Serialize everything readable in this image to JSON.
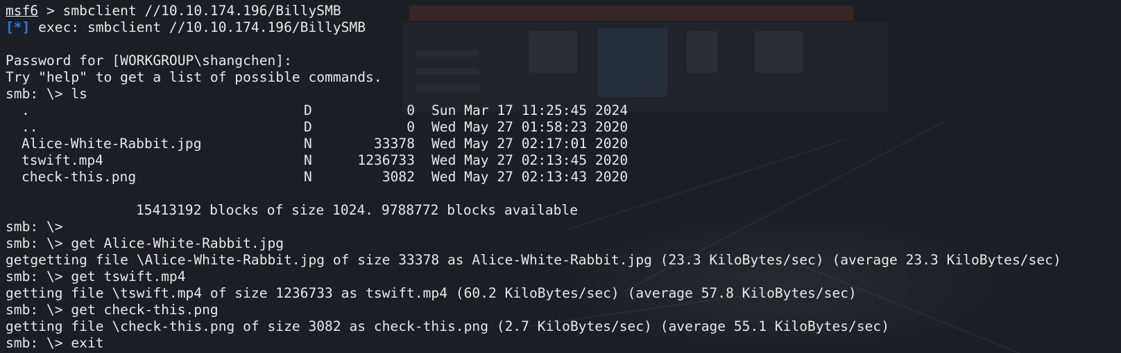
{
  "terminal": {
    "lines": [
      {
        "type": "msf",
        "prompt": "msf6",
        "sep": " > ",
        "command": "smbclient //10.10.174.196/BillySMB"
      },
      {
        "type": "exec",
        "marker": "[*]",
        "text": " exec: smbclient //10.10.174.196/BillySMB"
      },
      {
        "type": "blank"
      },
      {
        "type": "text",
        "text": "Password for [WORKGROUP\\shangchen]:"
      },
      {
        "type": "text",
        "text": "Try \"help\" to get a list of possible commands."
      },
      {
        "type": "text",
        "text": "smb: \\> ls"
      },
      {
        "type": "entry",
        "name": ".",
        "kind": "D",
        "size": "0",
        "date": "Sun Mar 17 11:25:45 2024"
      },
      {
        "type": "entry",
        "name": "..",
        "kind": "D",
        "size": "0",
        "date": "Wed May 27 01:58:23 2020"
      },
      {
        "type": "entry",
        "name": "Alice-White-Rabbit.jpg",
        "kind": "N",
        "size": "33378",
        "date": "Wed May 27 02:17:01 2020"
      },
      {
        "type": "entry",
        "name": "tswift.mp4",
        "kind": "N",
        "size": "1236733",
        "date": "Wed May 27 02:13:45 2020"
      },
      {
        "type": "entry",
        "name": "check-this.png",
        "kind": "N",
        "size": "3082",
        "date": "Wed May 27 02:13:43 2020"
      },
      {
        "type": "blank"
      },
      {
        "type": "blocks",
        "text": "15413192 blocks of size 1024. 9788772 blocks available"
      },
      {
        "type": "text",
        "text": "smb: \\>"
      },
      {
        "type": "text",
        "text": "smb: \\> get Alice-White-Rabbit.jpg"
      },
      {
        "type": "text",
        "text": "getgetting file \\Alice-White-Rabbit.jpg of size 33378 as Alice-White-Rabbit.jpg (23.3 KiloBytes/sec) (average 23.3 KiloBytes/sec)"
      },
      {
        "type": "text",
        "text": "smb: \\> get tswift.mp4"
      },
      {
        "type": "text",
        "text": "getting file \\tswift.mp4 of size 1236733 as tswift.mp4 (60.2 KiloBytes/sec) (average 57.8 KiloBytes/sec)"
      },
      {
        "type": "text",
        "text": "smb: \\> get check-this.png"
      },
      {
        "type": "text",
        "text": "getting file \\check-this.png of size 3082 as check-this.png (2.7 KiloBytes/sec) (average 55.1 KiloBytes/sec)"
      },
      {
        "type": "text",
        "text": "smb: \\> exit"
      }
    ]
  },
  "colors": {
    "background": "#1c1e25",
    "foreground": "#e8e8e8",
    "accent_marker": "#2f7ad8"
  }
}
